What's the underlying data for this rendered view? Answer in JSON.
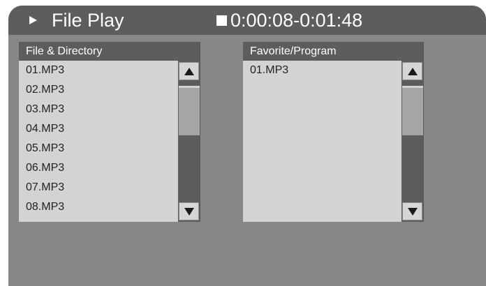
{
  "header": {
    "mode_icon": "play-icon",
    "title": "File Play",
    "state_icon": "stop-icon",
    "time": "0:00:08-0:01:48"
  },
  "file_panel": {
    "title": "File & Directory",
    "items": [
      "01.MP3",
      "02.MP3",
      "03.MP3",
      "04.MP3",
      "05.MP3",
      "06.MP3",
      "07.MP3",
      "08.MP3"
    ],
    "scroll_up_icon": "triangle-up-icon",
    "scroll_down_icon": "triangle-down-icon"
  },
  "program_panel": {
    "title": "Favorite/Program",
    "items": [
      "01.MP3"
    ],
    "scroll_up_icon": "triangle-up-icon",
    "scroll_down_icon": "triangle-down-icon"
  },
  "colors": {
    "screen_background": "#87878a",
    "bar_background": "#5d5d5f",
    "list_background": "#d3d3d4",
    "text_light": "#ffffff",
    "text_dark": "#222222"
  }
}
